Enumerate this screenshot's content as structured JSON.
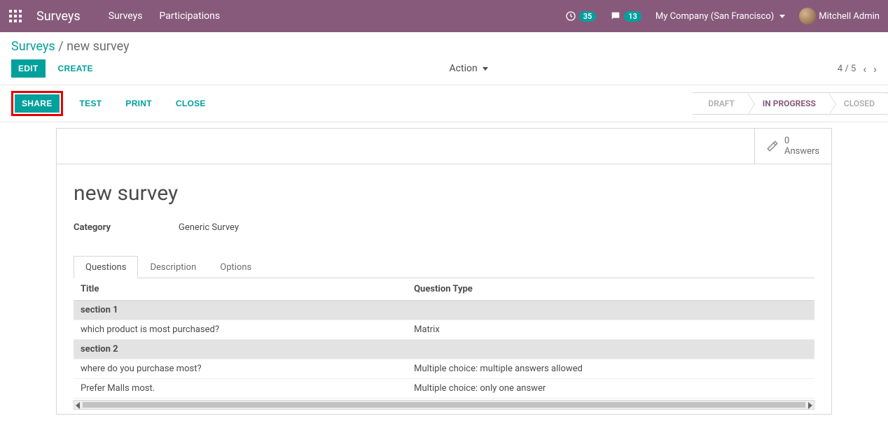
{
  "topbar": {
    "app_title": "Surveys",
    "menu": [
      "Surveys",
      "Participations"
    ],
    "activity_count": "35",
    "message_count": "13",
    "company": "My Company (San Francisco)",
    "user": "Mitchell Admin"
  },
  "breadcrumb": {
    "root": "Surveys",
    "current": "new survey"
  },
  "buttons": {
    "edit": "EDIT",
    "create": "CREATE",
    "action": "Action",
    "share": "SHARE",
    "test": "TEST",
    "print": "PRINT",
    "close": "CLOSE"
  },
  "pager": {
    "position": "4 / 5"
  },
  "status": {
    "draft": "DRAFT",
    "in_progress": "IN PROGRESS",
    "closed": "CLOSED"
  },
  "stat": {
    "count": "0",
    "label": "Answers"
  },
  "form": {
    "title": "new survey",
    "category_label": "Category",
    "category_value": "Generic Survey"
  },
  "tabs": {
    "questions": "Questions",
    "description": "Description",
    "options": "Options"
  },
  "table": {
    "col_title": "Title",
    "col_type": "Question Type",
    "rows": [
      {
        "section": true,
        "title": "section 1",
        "type": ""
      },
      {
        "section": false,
        "title": "which product is most purchased?",
        "type": "Matrix"
      },
      {
        "section": true,
        "title": "section 2",
        "type": ""
      },
      {
        "section": false,
        "title": "where do you purchase most?",
        "type": "Multiple choice: multiple answers allowed"
      },
      {
        "section": false,
        "title": "Prefer Malls most.",
        "type": "Multiple choice: only one answer"
      }
    ]
  }
}
